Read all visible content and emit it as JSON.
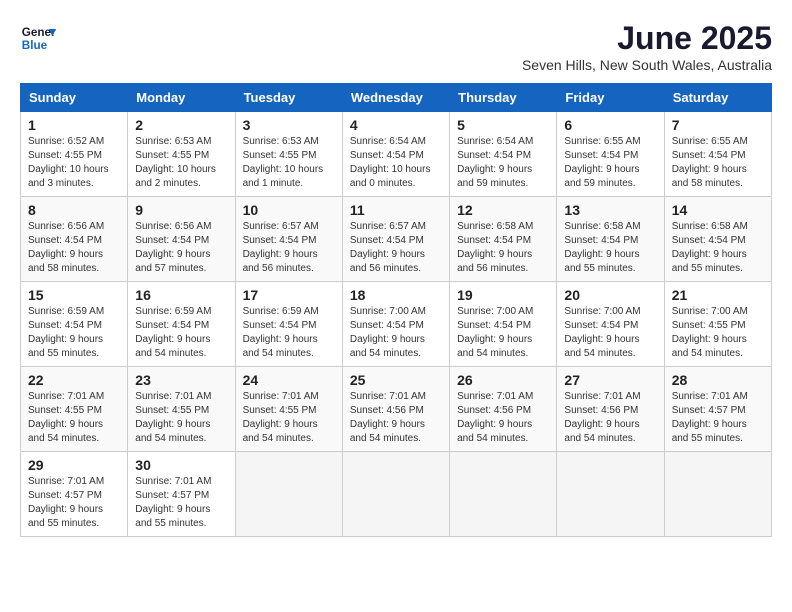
{
  "header": {
    "logo_line1": "General",
    "logo_line2": "Blue",
    "month": "June 2025",
    "location": "Seven Hills, New South Wales, Australia"
  },
  "weekdays": [
    "Sunday",
    "Monday",
    "Tuesday",
    "Wednesday",
    "Thursday",
    "Friday",
    "Saturday"
  ],
  "weeks": [
    [
      {
        "day": "1",
        "info": "Sunrise: 6:52 AM\nSunset: 4:55 PM\nDaylight: 10 hours\nand 3 minutes."
      },
      {
        "day": "2",
        "info": "Sunrise: 6:53 AM\nSunset: 4:55 PM\nDaylight: 10 hours\nand 2 minutes."
      },
      {
        "day": "3",
        "info": "Sunrise: 6:53 AM\nSunset: 4:55 PM\nDaylight: 10 hours\nand 1 minute."
      },
      {
        "day": "4",
        "info": "Sunrise: 6:54 AM\nSunset: 4:54 PM\nDaylight: 10 hours\nand 0 minutes."
      },
      {
        "day": "5",
        "info": "Sunrise: 6:54 AM\nSunset: 4:54 PM\nDaylight: 9 hours\nand 59 minutes."
      },
      {
        "day": "6",
        "info": "Sunrise: 6:55 AM\nSunset: 4:54 PM\nDaylight: 9 hours\nand 59 minutes."
      },
      {
        "day": "7",
        "info": "Sunrise: 6:55 AM\nSunset: 4:54 PM\nDaylight: 9 hours\nand 58 minutes."
      }
    ],
    [
      {
        "day": "8",
        "info": "Sunrise: 6:56 AM\nSunset: 4:54 PM\nDaylight: 9 hours\nand 58 minutes."
      },
      {
        "day": "9",
        "info": "Sunrise: 6:56 AM\nSunset: 4:54 PM\nDaylight: 9 hours\nand 57 minutes."
      },
      {
        "day": "10",
        "info": "Sunrise: 6:57 AM\nSunset: 4:54 PM\nDaylight: 9 hours\nand 56 minutes."
      },
      {
        "day": "11",
        "info": "Sunrise: 6:57 AM\nSunset: 4:54 PM\nDaylight: 9 hours\nand 56 minutes."
      },
      {
        "day": "12",
        "info": "Sunrise: 6:58 AM\nSunset: 4:54 PM\nDaylight: 9 hours\nand 56 minutes."
      },
      {
        "day": "13",
        "info": "Sunrise: 6:58 AM\nSunset: 4:54 PM\nDaylight: 9 hours\nand 55 minutes."
      },
      {
        "day": "14",
        "info": "Sunrise: 6:58 AM\nSunset: 4:54 PM\nDaylight: 9 hours\nand 55 minutes."
      }
    ],
    [
      {
        "day": "15",
        "info": "Sunrise: 6:59 AM\nSunset: 4:54 PM\nDaylight: 9 hours\nand 55 minutes."
      },
      {
        "day": "16",
        "info": "Sunrise: 6:59 AM\nSunset: 4:54 PM\nDaylight: 9 hours\nand 54 minutes."
      },
      {
        "day": "17",
        "info": "Sunrise: 6:59 AM\nSunset: 4:54 PM\nDaylight: 9 hours\nand 54 minutes."
      },
      {
        "day": "18",
        "info": "Sunrise: 7:00 AM\nSunset: 4:54 PM\nDaylight: 9 hours\nand 54 minutes."
      },
      {
        "day": "19",
        "info": "Sunrise: 7:00 AM\nSunset: 4:54 PM\nDaylight: 9 hours\nand 54 minutes."
      },
      {
        "day": "20",
        "info": "Sunrise: 7:00 AM\nSunset: 4:54 PM\nDaylight: 9 hours\nand 54 minutes."
      },
      {
        "day": "21",
        "info": "Sunrise: 7:00 AM\nSunset: 4:55 PM\nDaylight: 9 hours\nand 54 minutes."
      }
    ],
    [
      {
        "day": "22",
        "info": "Sunrise: 7:01 AM\nSunset: 4:55 PM\nDaylight: 9 hours\nand 54 minutes."
      },
      {
        "day": "23",
        "info": "Sunrise: 7:01 AM\nSunset: 4:55 PM\nDaylight: 9 hours\nand 54 minutes."
      },
      {
        "day": "24",
        "info": "Sunrise: 7:01 AM\nSunset: 4:55 PM\nDaylight: 9 hours\nand 54 minutes."
      },
      {
        "day": "25",
        "info": "Sunrise: 7:01 AM\nSunset: 4:56 PM\nDaylight: 9 hours\nand 54 minutes."
      },
      {
        "day": "26",
        "info": "Sunrise: 7:01 AM\nSunset: 4:56 PM\nDaylight: 9 hours\nand 54 minutes."
      },
      {
        "day": "27",
        "info": "Sunrise: 7:01 AM\nSunset: 4:56 PM\nDaylight: 9 hours\nand 54 minutes."
      },
      {
        "day": "28",
        "info": "Sunrise: 7:01 AM\nSunset: 4:57 PM\nDaylight: 9 hours\nand 55 minutes."
      }
    ],
    [
      {
        "day": "29",
        "info": "Sunrise: 7:01 AM\nSunset: 4:57 PM\nDaylight: 9 hours\nand 55 minutes."
      },
      {
        "day": "30",
        "info": "Sunrise: 7:01 AM\nSunset: 4:57 PM\nDaylight: 9 hours\nand 55 minutes."
      },
      {
        "day": "",
        "info": ""
      },
      {
        "day": "",
        "info": ""
      },
      {
        "day": "",
        "info": ""
      },
      {
        "day": "",
        "info": ""
      },
      {
        "day": "",
        "info": ""
      }
    ]
  ]
}
